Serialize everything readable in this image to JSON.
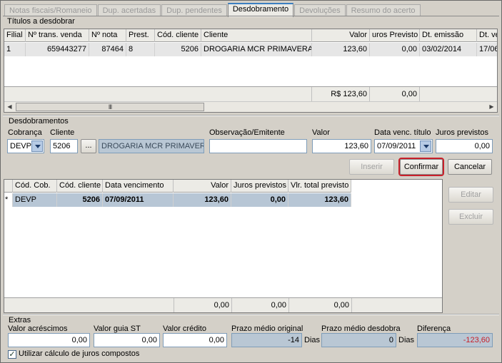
{
  "tabs": [
    {
      "label": "Notas fiscais/Romaneio",
      "active": false
    },
    {
      "label": "Dup. acertadas",
      "active": false
    },
    {
      "label": "Dup. pendentes",
      "active": false
    },
    {
      "label": "Desdobramento",
      "active": true
    },
    {
      "label": "Devoluções",
      "active": false
    },
    {
      "label": "Resumo do acerto",
      "active": false
    }
  ],
  "titulos": {
    "section_label": "Títulos a desdobrar",
    "headers": [
      "Filial",
      "Nº trans. venda",
      "Nº nota",
      "Prest.",
      "Cód. cliente",
      "Cliente",
      "Valor",
      "uros Previsto",
      "Dt. emissão",
      "Dt. ve"
    ],
    "rows": [
      [
        "1",
        "659443277",
        "87464",
        "8",
        "5206",
        "DROGARIA MCR PRIMAVERA LT",
        "123,60",
        "0,00",
        "03/02/2014",
        "17/06/"
      ]
    ],
    "footer_valor": "R$ 123,60",
    "footer_juros": "0,00"
  },
  "desdobramentos": {
    "section_label": "Desdobramentos",
    "cobranca_label": "Cobrança",
    "cobranca_value": "DEVP",
    "cliente_label": "Cliente",
    "cliente_code": "5206",
    "cliente_lookup": "...",
    "cliente_name": "DROGARIA MCR PRIMAVERA L",
    "observacao_label": "Observação/Emitente",
    "observacao_value": "",
    "valor_label": "Valor",
    "valor_value": "123,60",
    "data_venc_label": "Data venc. título",
    "data_venc_value": "07/09/2011",
    "juros_label": "Juros previstos",
    "juros_value": "0,00",
    "inserir_label": "Inserir",
    "confirmar_label": "Confirmar",
    "cancelar_label": "Cancelar"
  },
  "resultado": {
    "headers": [
      "",
      "Cód. Cob.",
      "Cód. cliente",
      "Data vencimento",
      "Valor",
      "Juros previstos",
      "Vlr. total previsto"
    ],
    "rows": [
      [
        "*",
        "DEVP",
        "5206",
        "07/09/2011",
        "123,60",
        "0,00",
        "123,60"
      ]
    ],
    "footer": [
      "0,00",
      "0,00",
      "0,00"
    ],
    "editar_label": "Editar",
    "excluir_label": "Excluir"
  },
  "extras": {
    "section_label": "Extras",
    "acrescimos_label": "Valor acréscimos",
    "acrescimos_value": "0,00",
    "guia_st_label": "Valor guia ST",
    "guia_st_value": "0,00",
    "credito_label": "Valor crédito",
    "credito_value": "0,00",
    "prazo_original_label": "Prazo médio original",
    "prazo_original_value": "-14",
    "prazo_desdobra_label": "Prazo médio desdobra",
    "prazo_desdobra_value": "0",
    "dias_label": "Dias",
    "diferenca_label": "Diferença",
    "diferenca_value": "-123,60",
    "juros_compostos_label": "Utilizar cálculo de juros compostos",
    "juros_compostos_checked": true
  },
  "colors": {
    "highlight": "#c8202a",
    "negative": "#c8202a",
    "accent": "#3c7fc1"
  }
}
